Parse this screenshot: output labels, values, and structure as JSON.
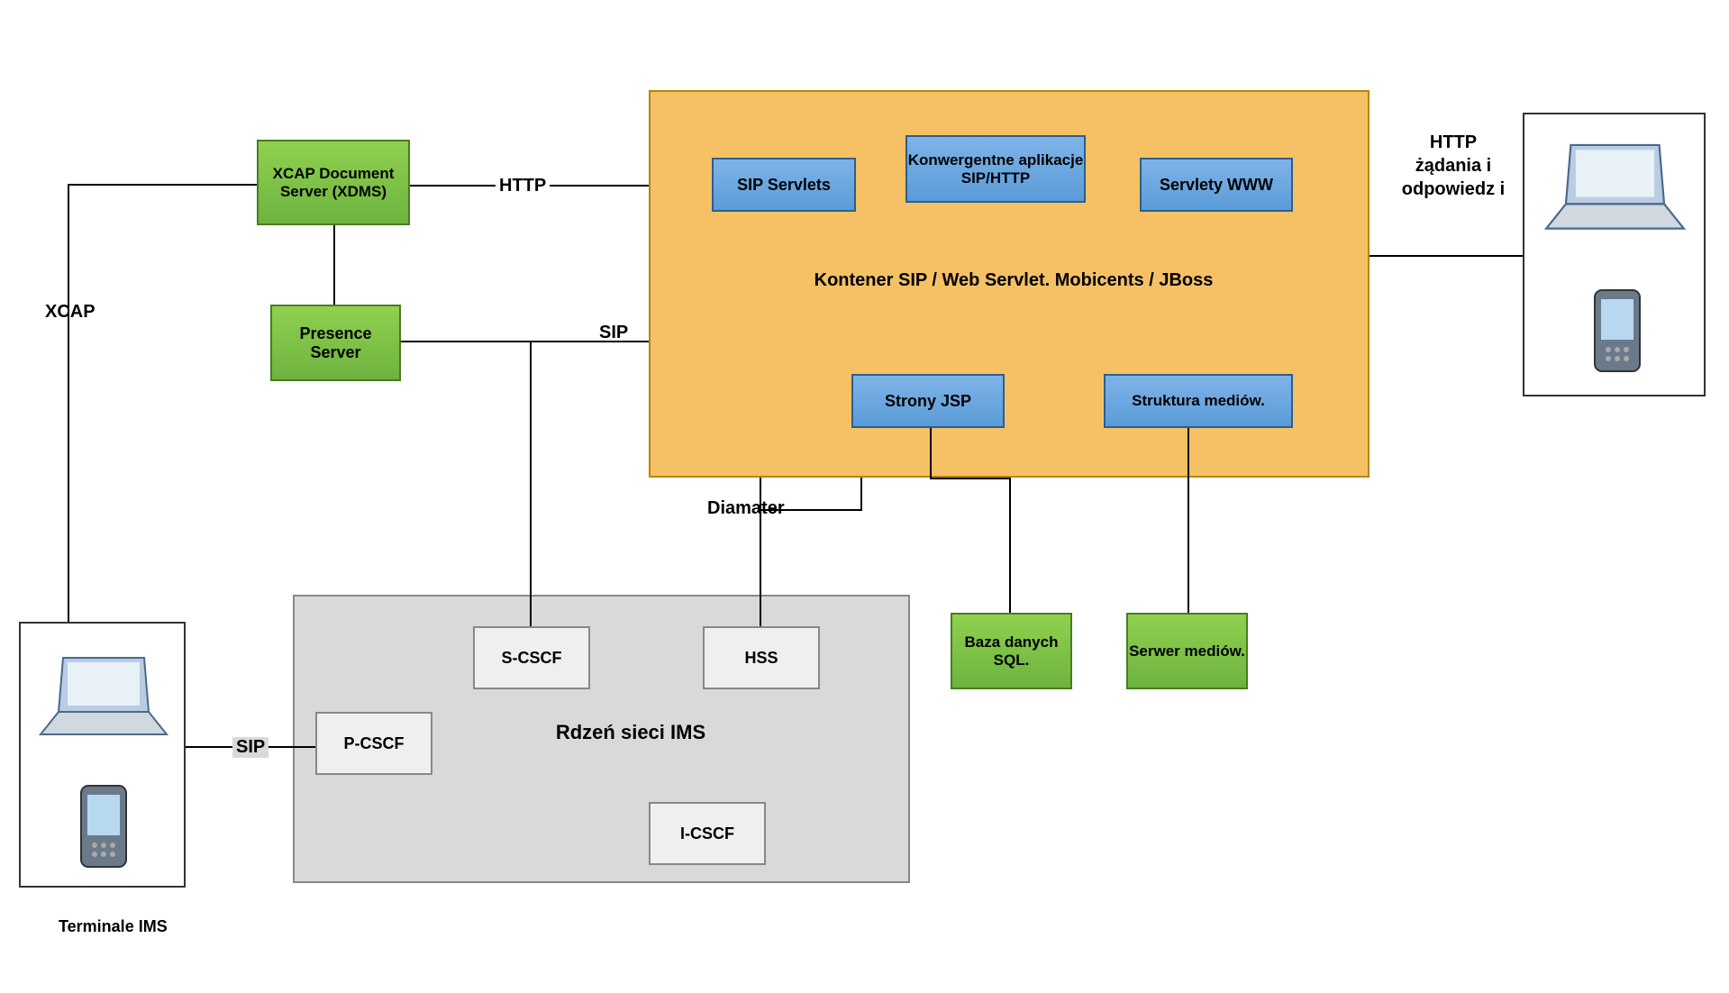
{
  "nodes": {
    "xcap_server": "XCAP Document Server (XDMS)",
    "presence_server": "Presence Server",
    "sip_servlets": "SIP Servlets",
    "konwergentne": "Konwergentne aplikacje SIP/HTTP",
    "servlety_www": "Servlety WWW",
    "strony_jsp": "Strony JSP",
    "struktura_mediow": "Struktura mediów.",
    "kontener_label": "Kontener SIP / Web Servlet. Mobicents / JBoss",
    "s_cscf": "S-CSCF",
    "hss": "HSS",
    "p_cscf": "P-CSCF",
    "i_cscf": "I-CSCF",
    "rdzen_label": "Rdzeń sieci IMS",
    "baza_danych": "Baza danych SQL.",
    "serwer_mediow": "Serwer mediów."
  },
  "edges": {
    "xcap": "XCAP",
    "http": "HTTP",
    "sip": "SIP",
    "sip2": "SIP",
    "diamater": "Diamater",
    "http_zadania": "HTTP żądania i odpowiedz i"
  },
  "terminale": "Terminale IMS"
}
